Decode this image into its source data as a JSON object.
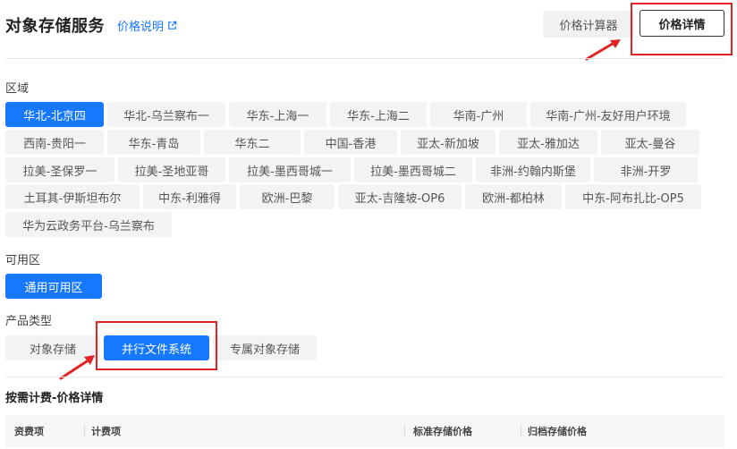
{
  "header": {
    "title": "对象存储服务",
    "price_link": "价格说明",
    "calc_button": "价格计算器",
    "detail_button": "价格详情"
  },
  "region": {
    "label": "区域",
    "items": [
      "华北-北京四",
      "华北-乌兰察布一",
      "华东-上海一",
      "华东-上海二",
      "华南-广州",
      "华南-广州-友好用户环境",
      "西南-贵阳一",
      "华东-青岛",
      "华东二",
      "中国-香港",
      "亚太-新加坡",
      "亚太-雅加达",
      "亚太-曼谷",
      "拉美-圣保罗一",
      "拉美-圣地亚哥",
      "拉美-墨西哥城一",
      "拉美-墨西哥城二",
      "非洲-约翰内斯堡",
      "非洲-开罗",
      "土耳其-伊斯坦布尔",
      "中东-利雅得",
      "欧洲-巴黎",
      "亚太-吉隆坡-OP6",
      "欧洲-都柏林",
      "中东-阿布扎比-OP5",
      "华为云政务平台-乌兰察布"
    ],
    "selected": "华北-北京四"
  },
  "az": {
    "label": "可用区",
    "items": [
      "通用可用区"
    ],
    "selected": "通用可用区"
  },
  "product": {
    "label": "产品类型",
    "items": [
      "对象存储",
      "并行文件系统",
      "专属对象存储"
    ],
    "selected": "并行文件系统"
  },
  "pricing": {
    "section_title": "按需计费-价格详情",
    "columns": [
      "资费项",
      "计费项",
      "标准存储价格",
      "归档存储价格"
    ]
  },
  "colors": {
    "accent": "#1677ff",
    "highlight": "#e02424"
  }
}
